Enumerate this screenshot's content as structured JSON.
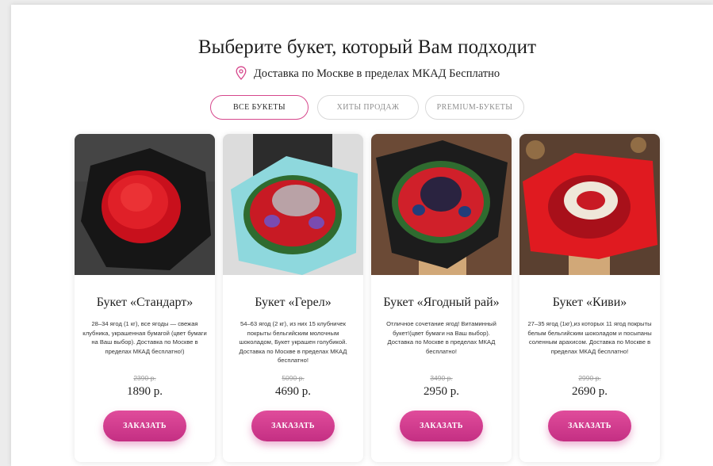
{
  "header": {
    "title": "Выберите букет, который Вам подходит",
    "delivery": "Доставка по Москве в пределах МКАД Бесплатно"
  },
  "tabs": [
    {
      "label": "ВСЕ БУКЕТЫ",
      "active": true
    },
    {
      "label": "ХИТЫ ПРОДАЖ",
      "active": false
    },
    {
      "label": "PREMIUM-БУКЕТЫ",
      "active": false
    }
  ],
  "products": [
    {
      "name": "Букет «Стандарт»",
      "desc": "28–34 ягод (1 кг), все ягоды — свежая клубника, украшенная бумагой (цвет бумаги на Ваш выбор). Доставка по Москве в пределах МКАД бесплатно!)",
      "old_price": "2390 р.",
      "price": "1890 р.",
      "button": "ЗАКАЗАТЬ"
    },
    {
      "name": "Букет «Герел»",
      "desc": "54–63 ягод (2 кг), из них 15 клубничек покрыты бельгийским молочным шоколадом, Букет украшен голубикой. Доставка по Москве в пределах МКАД бесплатно!",
      "old_price": "5090 р.",
      "price": "4690 р.",
      "button": "ЗАКАЗАТЬ"
    },
    {
      "name": "Букет «Ягодный рай»",
      "desc": "Отличное сочетание ягод! Витаминный букет!(цвет бумаги на Ваш выбор). Доставка по Москве в пределах МКАД бесплатно!",
      "old_price": "3490 р.",
      "price": "2950 р.",
      "button": "ЗАКАЗАТЬ"
    },
    {
      "name": "Букет «Киви»",
      "desc": "27–35 ягод (1кг),из которых 11 ягод покрыты белым бельгийским шоколадом и посыпаны соленным арахисом. Доставка по Москве в пределах МКАД бесплатно!",
      "old_price": "2990 р.",
      "price": "2690 р.",
      "button": "ЗАКАЗАТЬ"
    }
  ],
  "colors": {
    "accent": "#d6478c",
    "button": "#d33b8f"
  }
}
